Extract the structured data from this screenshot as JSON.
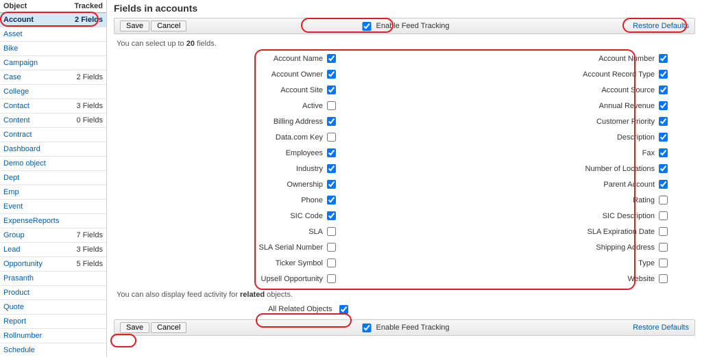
{
  "sidebar": {
    "header_object": "Object",
    "header_tracked": "Tracked",
    "rows": [
      {
        "name": "Account",
        "tracked": "2 Fields",
        "selected": true
      },
      {
        "name": "Asset",
        "tracked": ""
      },
      {
        "name": "Bike",
        "tracked": ""
      },
      {
        "name": "Campaign",
        "tracked": ""
      },
      {
        "name": "Case",
        "tracked": "2 Fields"
      },
      {
        "name": "College",
        "tracked": ""
      },
      {
        "name": "Contact",
        "tracked": "3 Fields"
      },
      {
        "name": "Content",
        "tracked": "0 Fields"
      },
      {
        "name": "Contract",
        "tracked": ""
      },
      {
        "name": "Dashboard",
        "tracked": ""
      },
      {
        "name": "Demo object",
        "tracked": ""
      },
      {
        "name": "Dept",
        "tracked": ""
      },
      {
        "name": "Emp",
        "tracked": ""
      },
      {
        "name": "Event",
        "tracked": ""
      },
      {
        "name": "ExpenseReports",
        "tracked": ""
      },
      {
        "name": "Group",
        "tracked": "7 Fields"
      },
      {
        "name": "Lead",
        "tracked": "3 Fields"
      },
      {
        "name": "Opportunity",
        "tracked": "5 Fields"
      },
      {
        "name": "Prasanth",
        "tracked": ""
      },
      {
        "name": "Product",
        "tracked": ""
      },
      {
        "name": "Quote",
        "tracked": ""
      },
      {
        "name": "Report",
        "tracked": ""
      },
      {
        "name": "Rollnumber",
        "tracked": ""
      },
      {
        "name": "Schedule",
        "tracked": ""
      }
    ]
  },
  "main": {
    "title": "Fields in accounts",
    "toolbar": {
      "save": "Save",
      "cancel": "Cancel",
      "enable_feed_tracking": "Enable Feed Tracking",
      "enable_feed_tracking_checked": true,
      "restore_defaults": "Restore Defaults"
    },
    "hint_prefix": "You can select up to ",
    "hint_bold": "20",
    "hint_suffix": " fields.",
    "fields_left": [
      {
        "label": "Account Name",
        "checked": true
      },
      {
        "label": "Account Owner",
        "checked": true
      },
      {
        "label": "Account Site",
        "checked": true
      },
      {
        "label": "Active",
        "checked": false
      },
      {
        "label": "Billing Address",
        "checked": true
      },
      {
        "label": "Data.com Key",
        "checked": false
      },
      {
        "label": "Employees",
        "checked": true
      },
      {
        "label": "Industry",
        "checked": true
      },
      {
        "label": "Ownership",
        "checked": true
      },
      {
        "label": "Phone",
        "checked": true
      },
      {
        "label": "SIC Code",
        "checked": true
      },
      {
        "label": "SLA",
        "checked": false
      },
      {
        "label": "SLA Serial Number",
        "checked": false
      },
      {
        "label": "Ticker Symbol",
        "checked": false
      },
      {
        "label": "Upsell Opportunity",
        "checked": false
      }
    ],
    "fields_right": [
      {
        "label": "Account Number",
        "checked": true
      },
      {
        "label": "Account Record Type",
        "checked": true
      },
      {
        "label": "Account Source",
        "checked": true
      },
      {
        "label": "Annual Revenue",
        "checked": true
      },
      {
        "label": "Customer Priority",
        "checked": true
      },
      {
        "label": "Description",
        "checked": true
      },
      {
        "label": "Fax",
        "checked": true
      },
      {
        "label": "Number of Locations",
        "checked": true
      },
      {
        "label": "Parent Account",
        "checked": true
      },
      {
        "label": "Rating",
        "checked": false
      },
      {
        "label": "SIC Description",
        "checked": false
      },
      {
        "label": "SLA Expiration Date",
        "checked": false
      },
      {
        "label": "Shipping Address",
        "checked": false
      },
      {
        "label": "Type",
        "checked": false
      },
      {
        "label": "Website",
        "checked": false
      }
    ],
    "related_hint_prefix": "You can also display feed activity for ",
    "related_hint_bold": "related",
    "related_hint_suffix": " objects.",
    "all_related_label": "All Related Objects",
    "all_related_checked": true,
    "toolbar2": {
      "save": "Save",
      "cancel": "Cancel",
      "enable_feed_tracking": "Enable Feed Tracking",
      "enable_feed_tracking_checked": true,
      "restore_defaults": "Restore Defaults"
    }
  }
}
